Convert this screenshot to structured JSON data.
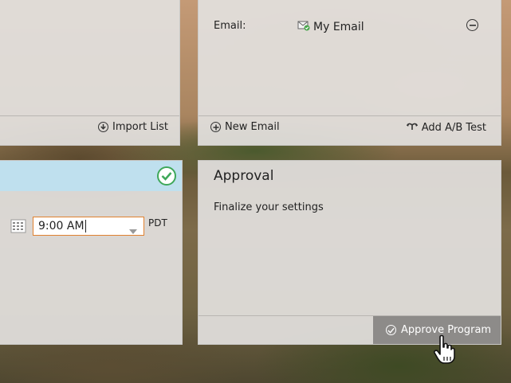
{
  "email_card": {
    "email_label": "Email:",
    "email_value": "My Email",
    "new_email_label": "New Email",
    "ab_test_label": "Add A/B Test"
  },
  "list_card": {
    "import_list_label": "Import List"
  },
  "schedule_card": {
    "time_value": "9:00 AM",
    "timezone": "PDT"
  },
  "approval_card": {
    "title": "Approval",
    "subtitle": "Finalize your settings",
    "approve_button_label": "Approve Program"
  },
  "colors": {
    "accent_orange": "#e0812f",
    "success_green": "#3fa85a",
    "band_blue": "#bfe0ee"
  }
}
